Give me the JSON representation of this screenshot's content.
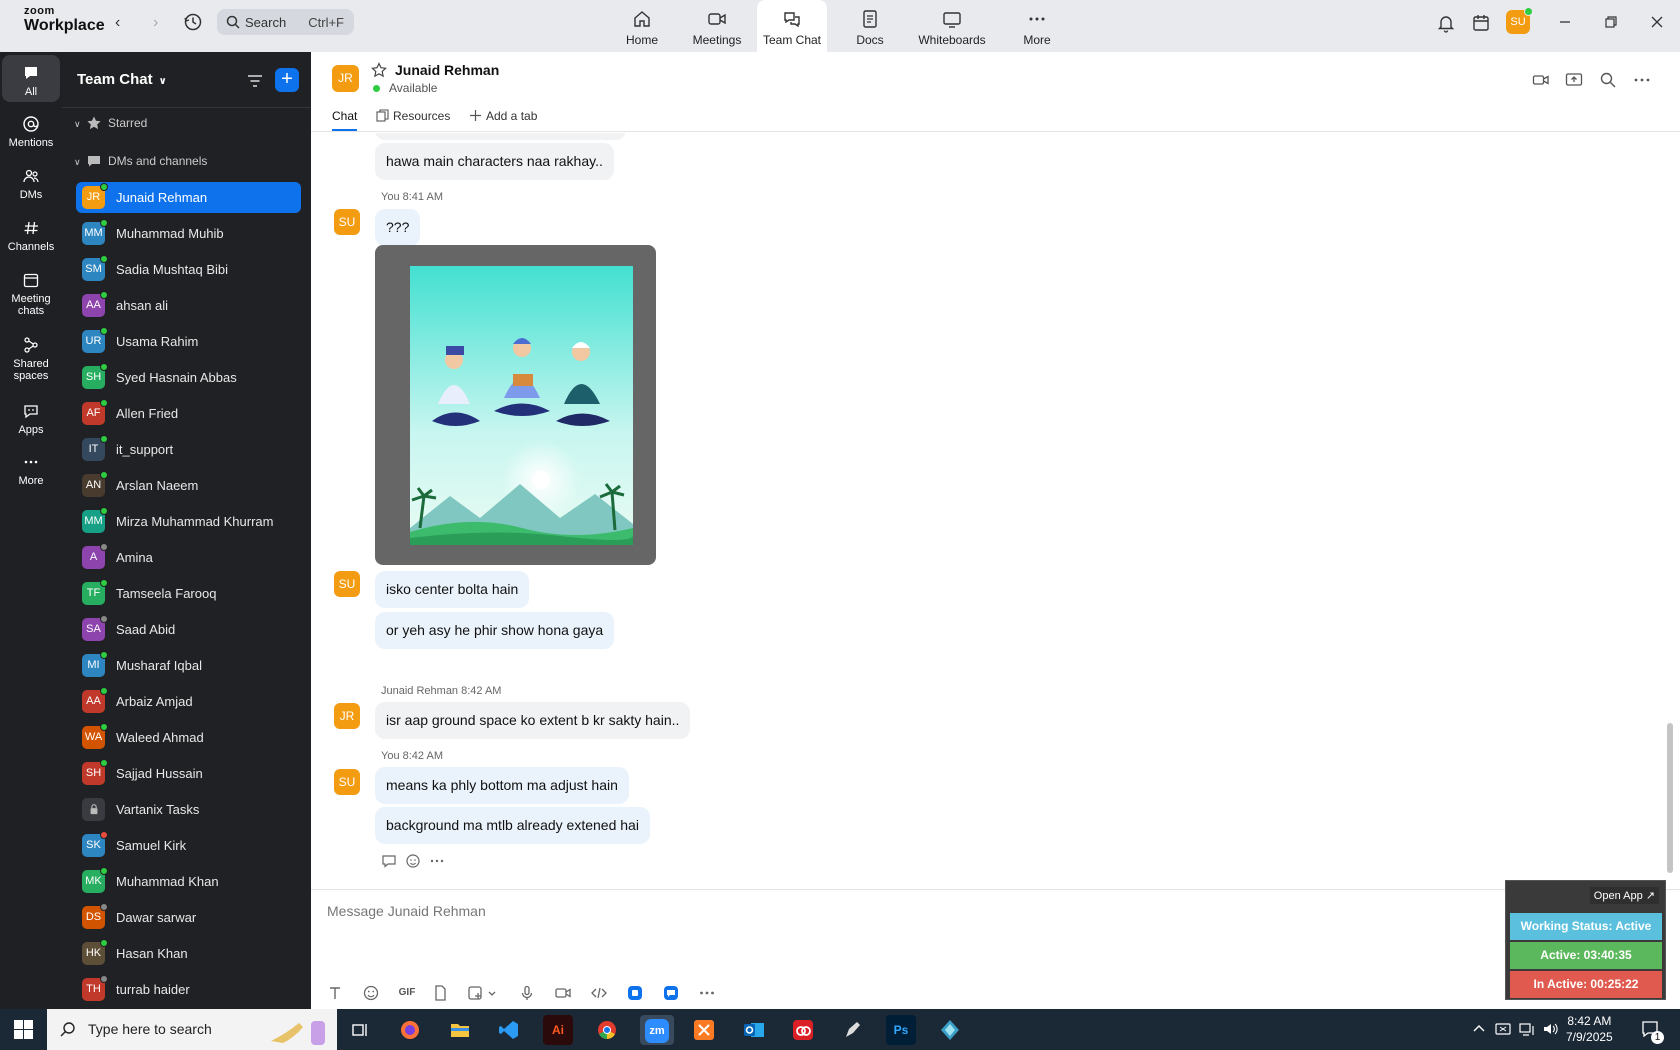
{
  "app": {
    "logo_line1": "zoom",
    "logo_line2": "Workplace",
    "search_placeholder": "Search",
    "search_shortcut": "Ctrl+F",
    "user_initials": "SU"
  },
  "nav_tabs": [
    {
      "label": "Home",
      "icon": "home-icon"
    },
    {
      "label": "Meetings",
      "icon": "video-camera-icon"
    },
    {
      "label": "Team Chat",
      "icon": "chat-bubbles-icon",
      "active": true
    },
    {
      "label": "Docs",
      "icon": "document-icon"
    },
    {
      "label": "Whiteboards",
      "icon": "whiteboard-icon"
    },
    {
      "label": "More",
      "icon": "more-horizontal-icon"
    }
  ],
  "rail": [
    {
      "label": "All",
      "icon": "chat-icon",
      "active": true
    },
    {
      "label": "Mentions",
      "icon": "at-sign-icon"
    },
    {
      "label": "DMs",
      "icon": "people-icon"
    },
    {
      "label": "Channels",
      "icon": "hash-icon"
    },
    {
      "label_1": "Meeting",
      "label_2": "chats",
      "icon": "calendar-icon"
    },
    {
      "label_1": "Shared",
      "label_2": "spaces",
      "icon": "share-nodes-icon"
    },
    {
      "label": "Apps",
      "icon": "apps-icon"
    },
    {
      "label": "More",
      "icon": "more-horizontal-icon"
    }
  ],
  "sidebar": {
    "title": "Team Chat",
    "section_starred": "Starred",
    "section_dms": "DMs and channels",
    "contacts": [
      {
        "initials": "JR",
        "name": "Junaid Rehman",
        "color": "#f39c12",
        "status": "#2ecc40",
        "active": true
      },
      {
        "initials": "MM",
        "name": "Muhammad Muhib",
        "color": "#2e86c1",
        "status": "#2ecc40"
      },
      {
        "initials": "SM",
        "name": "Sadia Mushtaq Bibi",
        "color": "#2e86c1",
        "status": "#2ecc40"
      },
      {
        "initials": "AA",
        "name": "ahsan ali",
        "color": "#8e44ad",
        "status": "#2ecc40"
      },
      {
        "initials": "UR",
        "name": "Usama Rahim",
        "color": "#2e86c1",
        "status": "#2ecc40"
      },
      {
        "initials": "SH",
        "name": "Syed Hasnain Abbas",
        "color": "#27ae60",
        "status": "#2ecc40"
      },
      {
        "initials": "AF",
        "name": "Allen Fried",
        "color": "#c0392b",
        "status": "#2ecc40"
      },
      {
        "initials": "IT",
        "name": "it_support",
        "color": "#34495e",
        "status": "#2ecc40"
      },
      {
        "initials": "AN",
        "name": "Arslan Naeem",
        "color": "#4a3b2f",
        "status": "#2ecc40"
      },
      {
        "initials": "MM",
        "name": "Mirza Muhammad Khurram",
        "color": "#16a085",
        "status": "#2ecc40"
      },
      {
        "initials": "A",
        "name": "Amina",
        "color": "#8e44ad",
        "status": "#888888"
      },
      {
        "initials": "TF",
        "name": "Tamseela Farooq",
        "color": "#27ae60",
        "status": "#2ecc40"
      },
      {
        "initials": "SA",
        "name": "Saad Abid",
        "color": "#8e44ad",
        "status": "#888888"
      },
      {
        "initials": "MI",
        "name": "Musharaf Iqbal",
        "color": "#2e86c1",
        "status": "#2ecc40"
      },
      {
        "initials": "AA",
        "name": "Arbaiz Amjad",
        "color": "#c0392b",
        "status": "#2ecc40"
      },
      {
        "initials": "WA",
        "name": "Waleed Ahmad",
        "color": "#d35400",
        "status": "#2ecc40"
      },
      {
        "initials": "SH",
        "name": "Sajjad Hussain",
        "color": "#c0392b",
        "status": "#2ecc40"
      },
      {
        "initials": "",
        "name": "Vartanix Tasks",
        "color": "#3a3b40",
        "status": ""
      },
      {
        "initials": "SK",
        "name": "Samuel Kirk",
        "color": "#2e86c1",
        "status": "#e74c3c"
      },
      {
        "initials": "MK",
        "name": "Muhammad Khan",
        "color": "#27ae60",
        "status": "#2ecc40"
      },
      {
        "initials": "DS",
        "name": "Dawar sarwar",
        "color": "#d35400",
        "status": "#888888"
      },
      {
        "initials": "HK",
        "name": "Hasan Khan",
        "color": "#5d4e37",
        "status": "#2ecc40"
      },
      {
        "initials": "TH",
        "name": "turrab haider",
        "color": "#c0392b",
        "status": "#888888"
      }
    ]
  },
  "chat": {
    "contact_initials": "JR",
    "contact_name": "Junaid Rehman",
    "contact_status": "Available",
    "tab_chat": "Chat",
    "tab_resources": "Resources",
    "tab_add": "Add a tab",
    "messages": {
      "m1_text": "hawa main characters naa rakhay..",
      "m2_meta": "You 8:41 AM",
      "m2_text": "???",
      "m3_meta": "You 8:41 AM",
      "m3_text": "isko center bolta hain",
      "m4_text": "or yeh asy he phir show hona gaya",
      "m5_meta": "Junaid Rehman 8:42 AM",
      "m5_text": "isr aap ground space ko extent b kr sakty hain..",
      "m6_meta": "You 8:42 AM",
      "m6_text": "means ka phly bottom ma adjust hain",
      "m7_text": "background ma mtlb already extened hai"
    },
    "composer_placeholder": "Message Junaid Rehman",
    "gif_label": "GIF"
  },
  "widget": {
    "open_app": "Open App ↗",
    "working_status": "Working Status: Active",
    "active": "Active: 03:40:35",
    "inactive": "In Active: 00:25:22",
    "colors": {
      "status": "#5bc0de",
      "active": "#5cb85c",
      "inactive": "#e05a4f"
    }
  },
  "taskbar": {
    "search_placeholder": "Type here to search",
    "time": "8:42 AM",
    "date": "7/9/2025",
    "notification_count": "1",
    "apps": [
      {
        "name": "task-view",
        "label": ""
      },
      {
        "name": "firefox",
        "label": ""
      },
      {
        "name": "file-explorer",
        "label": ""
      },
      {
        "name": "vscode",
        "label": ""
      },
      {
        "name": "illustrator",
        "label": "Ai"
      },
      {
        "name": "chrome",
        "label": ""
      },
      {
        "name": "zoom",
        "label": "zm"
      },
      {
        "name": "xampp",
        "label": ""
      },
      {
        "name": "outlook",
        "label": ""
      },
      {
        "name": "creative-cloud",
        "label": ""
      },
      {
        "name": "pen-tool",
        "label": ""
      },
      {
        "name": "photoshop",
        "label": "Ps"
      },
      {
        "name": "app-diamond",
        "label": ""
      }
    ]
  }
}
